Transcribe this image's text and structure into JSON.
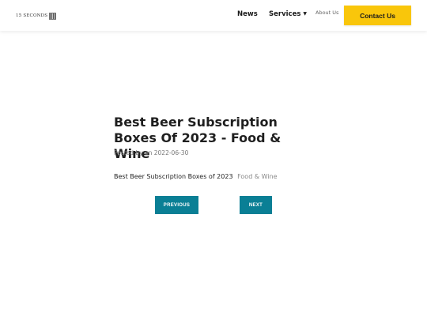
{
  "header": {
    "logo_text": "15 SECONDS",
    "nav": {
      "news": "News",
      "services": "Services",
      "about": "About Us"
    },
    "contact_label": "Contact Us"
  },
  "post": {
    "title": "Best Beer Subscription Boxes Of 2023 - Food & Wine",
    "meta": "Posted by on 2022-06-30",
    "body_text": "Best Beer Subscription Boxes of 2023",
    "source": "Food & Wine"
  },
  "pagination": {
    "previous": "PREVIOUS",
    "next": "NEXT"
  },
  "colors": {
    "accent_yellow": "#f9c60b",
    "button_teal": "#0a7f95"
  }
}
